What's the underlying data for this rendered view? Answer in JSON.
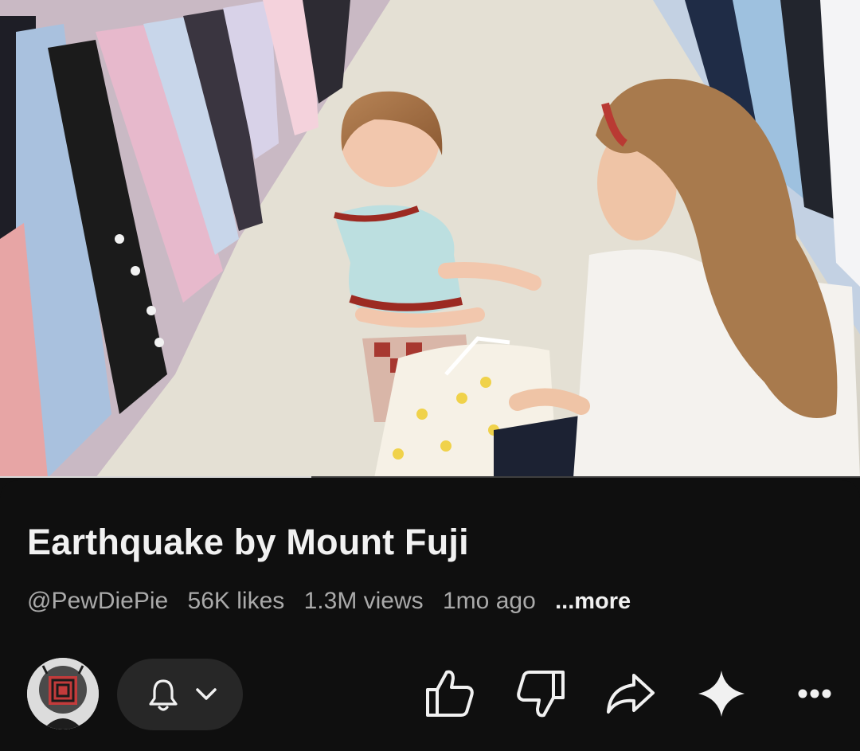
{
  "video": {
    "progress_fraction": 0.362,
    "thumbnail_description_icon": "video-frame"
  },
  "info": {
    "title": "Earthquake by Mount Fuji",
    "channel": "@PewDiePie",
    "likes": "56K likes",
    "views": "1.3M views",
    "age": "1mo ago",
    "more": "...more"
  },
  "actions": {
    "subscribe_icon": "bell-icon",
    "dropdown_icon": "chevron-down-icon",
    "like_icon": "thumbs-up-icon",
    "dislike_icon": "thumbs-down-icon",
    "share_icon": "share-icon",
    "ai_icon": "sparkle-icon",
    "more_icon": "more-icon"
  },
  "colors": {
    "background": "#0f0f0f",
    "text_primary": "#f1f1f1",
    "text_secondary": "#aaaaaa",
    "pill": "#272727"
  }
}
